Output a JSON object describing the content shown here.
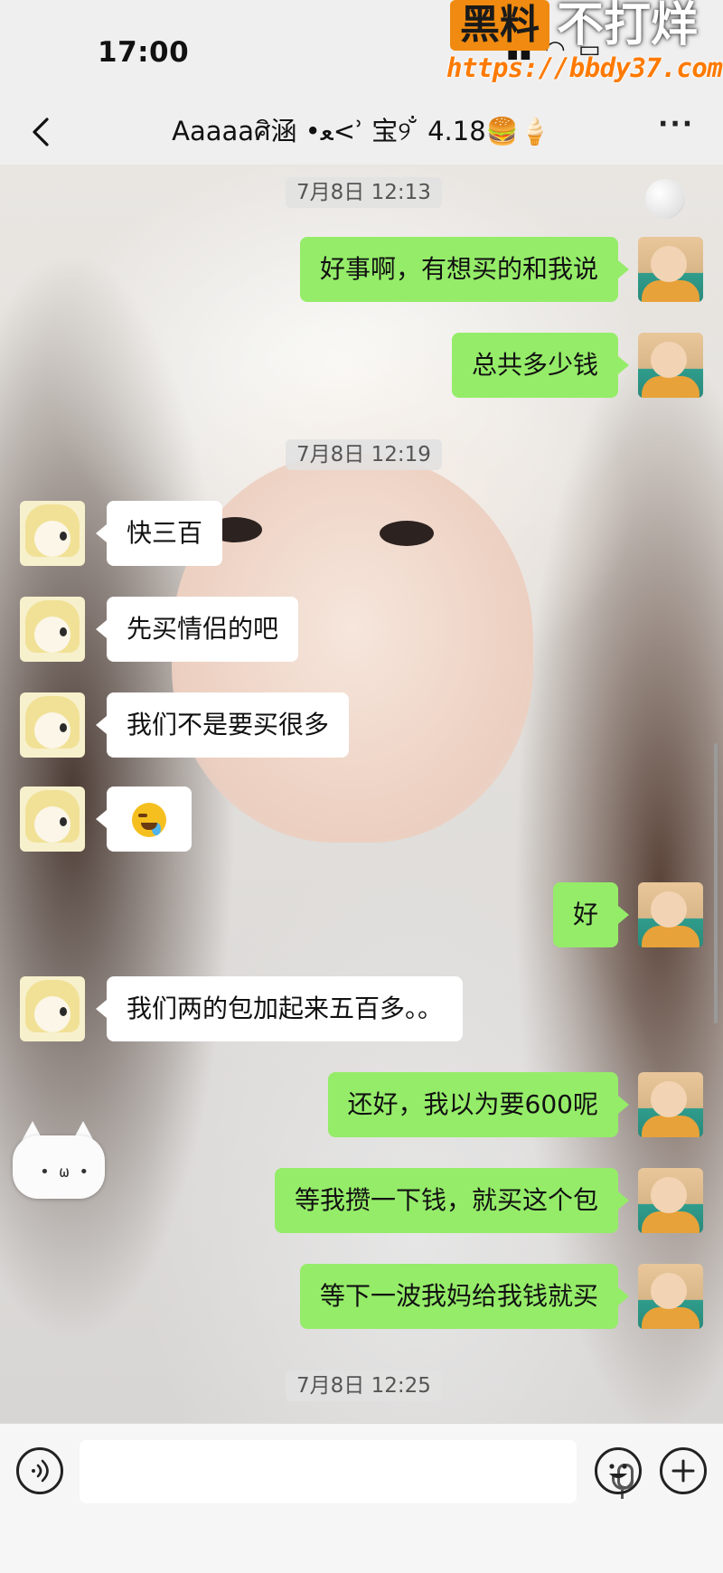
{
  "status_bar": {
    "time": "17:00"
  },
  "watermark": {
    "badge": "黑料",
    "slogan": "不打烊",
    "url": "https://bbdy37.com"
  },
  "header": {
    "title": "Aaaaaศิ涵 •ﻌ<ʾ 宝୨ ̐ 4.18🍔🍦",
    "more": "···"
  },
  "messages": [
    {
      "type": "timestamp",
      "text": "7月8日 12:13"
    },
    {
      "type": "sent",
      "text": "好事啊，有想买的和我说"
    },
    {
      "type": "sent",
      "text": "总共多少钱"
    },
    {
      "type": "timestamp",
      "text": "7月8日 12:19"
    },
    {
      "type": "received",
      "text": "快三百"
    },
    {
      "type": "received",
      "text": "先买情侣的吧"
    },
    {
      "type": "received",
      "text": "我们不是要买很多"
    },
    {
      "type": "received",
      "emoji": "face-with-tears-of-joy"
    },
    {
      "type": "sent",
      "text": "好"
    },
    {
      "type": "received",
      "text": "我们两的包加起来五百多。。"
    },
    {
      "type": "sent",
      "text": "还好，我以为要600呢"
    },
    {
      "type": "sent",
      "text": "等我攒一下钱，就买这个包"
    },
    {
      "type": "sent",
      "text": "等下一波我妈给我钱就买"
    },
    {
      "type": "timestamp",
      "text": "7月8日 12:25"
    }
  ],
  "colors": {
    "sent_bubble": "#95ec69",
    "received_bubble": "#ffffff",
    "bar_background": "#f6f6f6"
  }
}
